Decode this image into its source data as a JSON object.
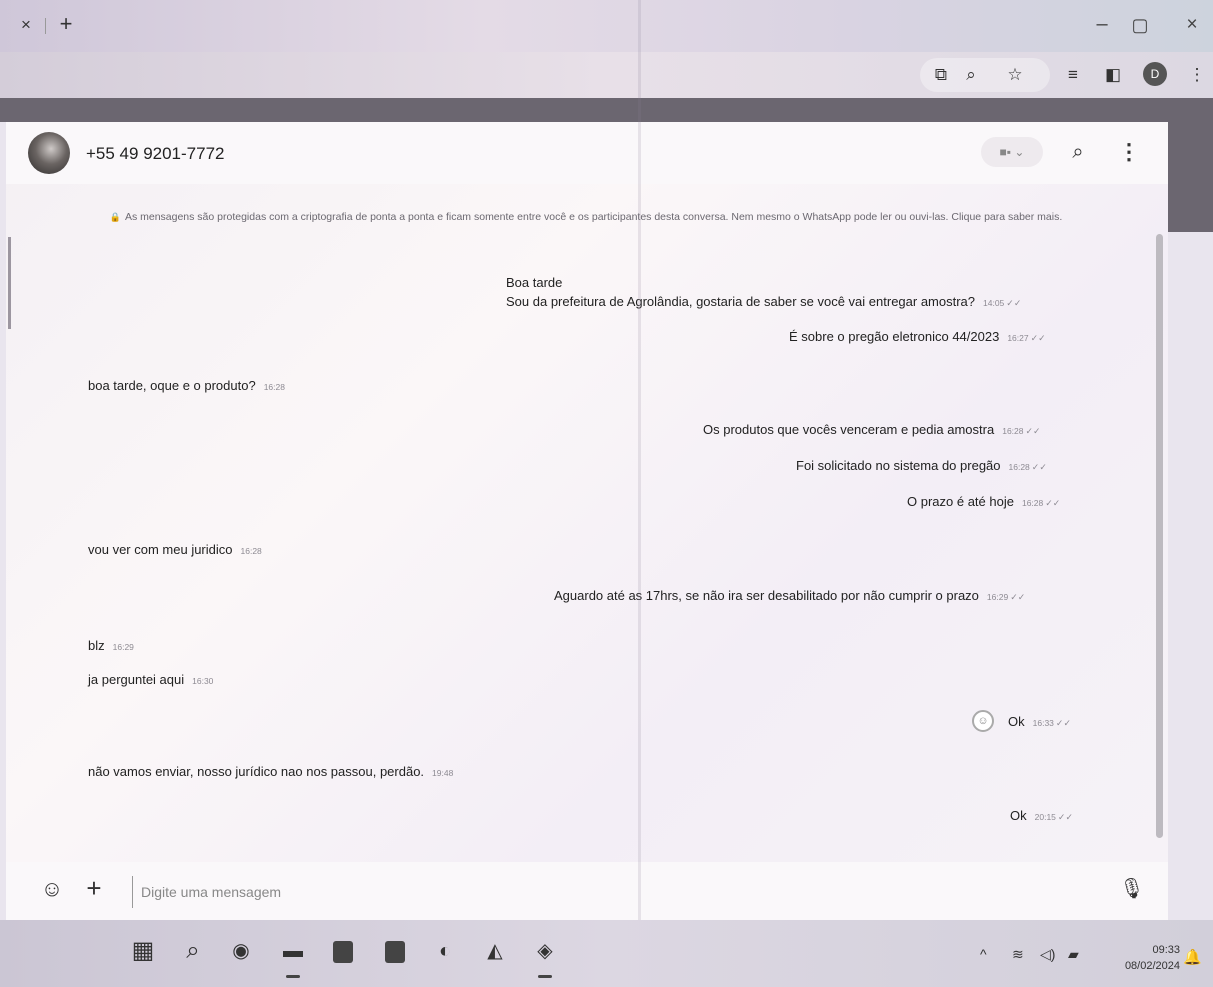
{
  "browser": {
    "tab_close": "×",
    "tab_new": "+",
    "window": {
      "minimize": "–",
      "maximize": "▢",
      "close": "×"
    },
    "profile_initial": "D"
  },
  "chat": {
    "contact": "+55 49 9201-7772",
    "video_caret": "■▪ ⌄",
    "encryption_notice": "As mensagens são protegidas com a criptografia de ponta a ponta e ficam somente entre você e os participantes desta conversa. Nem mesmo o WhatsApp pode ler ou ouvi-las. Clique para saber mais.",
    "messages": [
      {
        "dir": "out",
        "lines": [
          "Boa tarde",
          "Sou da prefeitura de Agrolândia, gostaria de saber se você vai entregar amostra?"
        ],
        "time": "14:05"
      },
      {
        "dir": "out",
        "lines": [
          "É sobre o pregão eletronico 44/2023"
        ],
        "time": "16:27"
      },
      {
        "dir": "in",
        "lines": [
          "boa tarde, oque e o produto?"
        ],
        "time": "16:28"
      },
      {
        "dir": "out",
        "lines": [
          "Os produtos que vocês venceram e pedia amostra"
        ],
        "time": "16:28"
      },
      {
        "dir": "out",
        "lines": [
          "Foi solicitado no sistema do pregão"
        ],
        "time": "16:28"
      },
      {
        "dir": "out",
        "lines": [
          "O prazo é até hoje"
        ],
        "time": "16:28"
      },
      {
        "dir": "in",
        "lines": [
          "vou ver com meu juridico"
        ],
        "time": "16:28"
      },
      {
        "dir": "out",
        "lines": [
          "Aguardo até as 17hrs, se não ira ser desabilitado por não cumprir o prazo"
        ],
        "time": "16:29"
      },
      {
        "dir": "in",
        "lines": [
          "blz"
        ],
        "time": "16:29"
      },
      {
        "dir": "in",
        "lines": [
          "ja perguntei aqui"
        ],
        "time": "16:30"
      },
      {
        "dir": "out",
        "lines": [
          "Ok"
        ],
        "time": "16:33"
      },
      {
        "dir": "in",
        "lines": [
          "não vamos enviar, nosso jurídico nao nos passou, perdão."
        ],
        "time": "19:48"
      },
      {
        "dir": "out",
        "lines": [
          "Ok"
        ],
        "time": "20:15"
      }
    ],
    "composer_placeholder": "Digite uma mensagem"
  },
  "taskbar": {
    "time": "09:33",
    "date": "08/02/2024"
  }
}
